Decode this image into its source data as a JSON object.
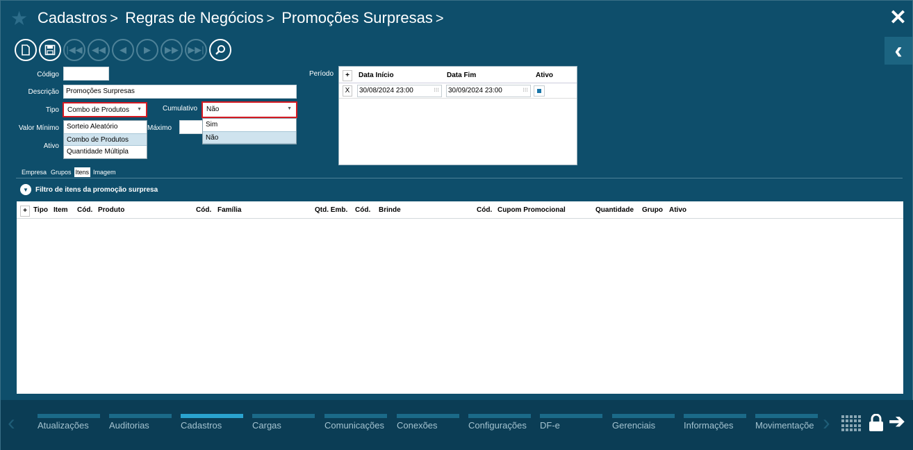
{
  "breadcrumb": [
    "Cadastros",
    "Regras de Negócios",
    "Promoções Surpresas"
  ],
  "form": {
    "codigo_label": "Código",
    "codigo_value": "",
    "descricao_label": "Descrição",
    "descricao_value": "Promoções Surpresas",
    "tipo_label": "Tipo",
    "tipo_value": "Combo de Produtos",
    "tipo_options": [
      "Sorteio Aleatório",
      "Combo de Produtos",
      "Quantidade Múltipla"
    ],
    "cumulativo_label": "Cumulativo",
    "cumulativo_value": "Não",
    "cumulativo_options": [
      "Sim",
      "Não"
    ],
    "valor_minimo_label": "Valor Mínimo",
    "maximo_label": "Máximo",
    "ativo_label": "Ativo",
    "periodo_label": "Período"
  },
  "periodo": {
    "add_label": "+",
    "columns": [
      "Data Início",
      "Data Fim",
      "Ativo"
    ],
    "rows": [
      {
        "remove": "X",
        "inicio": "30/08/2024 23:00",
        "fim": "30/09/2024 23:00",
        "ativo": true
      }
    ]
  },
  "tabs": [
    "Empresa",
    "Grupos",
    "Itens",
    "Imagem"
  ],
  "active_tab": "Itens",
  "filtro_label": "Filtro de itens da promoção surpresa",
  "grid": {
    "add_label": "+",
    "columns": [
      "Tipo",
      "Item",
      "Cód.",
      "Produto",
      "Cód.",
      "Família",
      "Qtd. Emb.",
      "Cód.",
      "Brinde",
      "Cód.",
      "Cupom Promocional",
      "Quantidade",
      "Grupo",
      "Ativo"
    ]
  },
  "bottom_nav": [
    "Atualizações",
    "Auditorias",
    "Cadastros",
    "Cargas",
    "Comunicações",
    "Conexões",
    "Configurações",
    "DF-e",
    "Gerenciais",
    "Informações",
    "Movimentaçõe"
  ],
  "bottom_nav_active": "Cadastros",
  "icons": {
    "star": "star-icon",
    "close": "close-icon",
    "back": "chevron-left-icon",
    "toolbar": [
      "new-document-icon",
      "save-icon",
      "first-record-icon",
      "previous-page-icon",
      "previous-record-icon",
      "next-record-icon",
      "next-page-icon",
      "last-record-icon",
      "search-icon"
    ]
  },
  "colors": {
    "background": "#0e4e6b",
    "highlight_border": "#d51a22",
    "nav_active": "#2aa3cf"
  }
}
